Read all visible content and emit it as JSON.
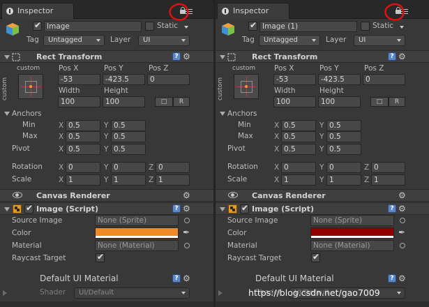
{
  "annotation_color": "#e01010",
  "watermark": "https://blog.csdn.net/gao7009",
  "panels": [
    {
      "tab_title": "Inspector",
      "object_name": "Image",
      "static_label": "Static",
      "tag_label": "Tag",
      "tag_value": "Untagged",
      "layer_label": "Layer",
      "layer_value": "UI",
      "rect_transform": {
        "title": "Rect Transform",
        "custom_top": "custom",
        "custom_side": "custom",
        "pos_x_label": "Pos X",
        "pos_y_label": "Pos Y",
        "pos_z_label": "Pos Z",
        "pos_x": "-53",
        "pos_y": "-423.5",
        "pos_z": "0",
        "width_label": "Width",
        "height_label": "Height",
        "width": "100",
        "height": "100",
        "r_label": "R",
        "anchors_label": "Anchors",
        "min_label": "Min",
        "max_label": "Max",
        "pivot_label": "Pivot",
        "min_x": "0.5",
        "min_y": "0.5",
        "max_x": "0.5",
        "max_y": "0.5",
        "pivot_x": "0.5",
        "pivot_y": "0.5",
        "rotation_label": "Rotation",
        "scale_label": "Scale",
        "rot_x": "0",
        "rot_y": "0",
        "rot_z": "0",
        "scale_x": "1",
        "scale_y": "1",
        "scale_z": "1",
        "x": "X",
        "y": "Y",
        "z": "Z"
      },
      "canvas_renderer": {
        "title": "Canvas Renderer"
      },
      "image_script": {
        "title": "Image (Script)",
        "source_image_label": "Source Image",
        "source_image_value": "None (Sprite)",
        "color_label": "Color",
        "color_value": "#f08a24",
        "material_label": "Material",
        "material_value": "None (Material)",
        "raycast_label": "Raycast Target"
      },
      "default_material": {
        "title": "Default UI Material",
        "shader_label": "Shader",
        "shader_value": "UI/Default"
      }
    },
    {
      "tab_title": "Inspector",
      "object_name": "Image (1)",
      "static_label": "Static",
      "tag_label": "Tag",
      "tag_value": "Untagged",
      "layer_label": "Layer",
      "layer_value": "UI",
      "rect_transform": {
        "title": "Rect Transform",
        "custom_top": "custom",
        "custom_side": "custom",
        "pos_x_label": "Pos X",
        "pos_y_label": "Pos Y",
        "pos_z_label": "Pos Z",
        "pos_x": "-53",
        "pos_y": "-423.5",
        "pos_z": "0",
        "width_label": "Width",
        "height_label": "Height",
        "width": "100",
        "height": "100",
        "r_label": "R",
        "anchors_label": "Anchors",
        "min_label": "Min",
        "max_label": "Max",
        "pivot_label": "Pivot",
        "min_x": "0.5",
        "min_y": "0.5",
        "max_x": "0.5",
        "max_y": "0.5",
        "pivot_x": "0.5",
        "pivot_y": "0.5",
        "rotation_label": "Rotation",
        "scale_label": "Scale",
        "rot_x": "0",
        "rot_y": "0",
        "rot_z": "0",
        "scale_x": "1",
        "scale_y": "1",
        "scale_z": "1",
        "x": "X",
        "y": "Y",
        "z": "Z"
      },
      "canvas_renderer": {
        "title": "Canvas Renderer"
      },
      "image_script": {
        "title": "Image (Script)",
        "source_image_label": "Source Image",
        "source_image_value": "None (Sprite)",
        "color_label": "Color",
        "color_value": "#8f0000",
        "material_label": "Material",
        "material_value": "None (Material)",
        "raycast_label": "Raycast Target"
      },
      "default_material": {
        "title": "Default UI Material",
        "shader_label": "Shader",
        "shader_value": "UI/Default"
      }
    }
  ]
}
